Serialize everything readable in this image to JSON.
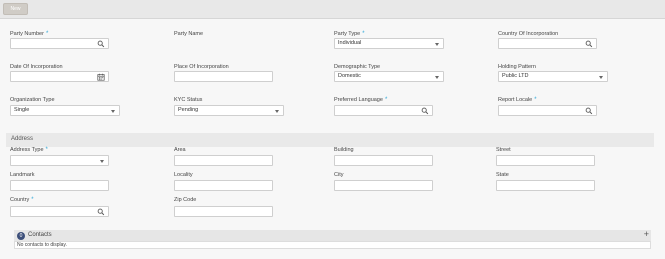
{
  "toolbar": {
    "new_label": "New"
  },
  "fields": {
    "party_number": {
      "label": "Party Number",
      "value": ""
    },
    "party_name": {
      "label": "Party Name"
    },
    "party_type": {
      "label": "Party Type",
      "value": "Individual"
    },
    "country_of_incorporation": {
      "label": "Country Of Incorporation",
      "value": ""
    },
    "date_of_incorporation": {
      "label": "Date Of Incorporation",
      "value": ""
    },
    "place_of_incorporation": {
      "label": "Place Of Incorporation",
      "value": ""
    },
    "demographic_type": {
      "label": "Demographic Type",
      "value": "Domestic"
    },
    "holding_pattern": {
      "label": "Holding Pattern",
      "value": "Public LTD"
    },
    "organization_type": {
      "label": "Organization Type",
      "value": "Single"
    },
    "kyc_status": {
      "label": "KYC Status",
      "value": "Pending"
    },
    "preferred_language": {
      "label": "Preferred Language",
      "value": ""
    },
    "report_locale": {
      "label": "Report Locale",
      "value": ""
    }
  },
  "address": {
    "section_title": "Address",
    "address_type": {
      "label": "Address Type",
      "value": ""
    },
    "area": {
      "label": "Area",
      "value": ""
    },
    "building": {
      "label": "Building",
      "value": ""
    },
    "street": {
      "label": "Street",
      "value": ""
    },
    "landmark": {
      "label": "Landmark",
      "value": ""
    },
    "locality": {
      "label": "Locality",
      "value": ""
    },
    "city": {
      "label": "City",
      "value": ""
    },
    "state": {
      "label": "State",
      "value": ""
    },
    "country": {
      "label": "Country",
      "value": ""
    },
    "zip_code": {
      "label": "Zip Code",
      "value": ""
    }
  },
  "required_marker": "*",
  "contacts": {
    "count": "0",
    "title": "Contacts",
    "add_symbol": "+",
    "empty_text": "No contacts to display."
  },
  "icons": {
    "search": "search-icon",
    "calendar": "calendar-icon",
    "dropdown": "chevron-down-icon"
  },
  "colors": {
    "required": "#2aa5d6",
    "badge": "#3d4f7a"
  }
}
